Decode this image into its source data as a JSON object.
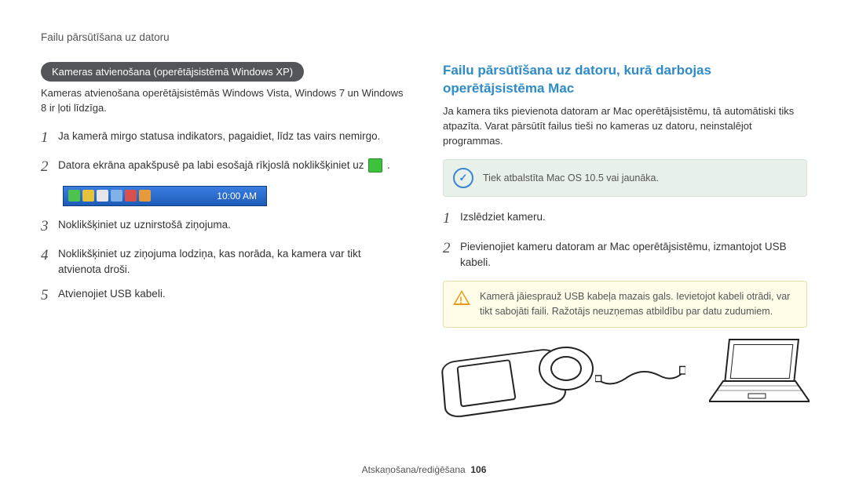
{
  "header": "Failu pārsūtīšana uz datoru",
  "left": {
    "pill": "Kameras atvienošana (operētājsistēmā Windows XP)",
    "subtext": "Kameras atvienošana operētājsistēmās Windows Vista, Windows 7 un Windows 8 ir ļoti līdzīga.",
    "steps": {
      "s1": "Ja kamerā mirgo statusa indikators, pagaidiet, līdz tas vairs nemirgo.",
      "s2a": "Datora ekrāna apakšpusē pa labi esošajā rīkjoslā noklikšķiniet uz ",
      "s2b": ".",
      "s3": "Noklikšķiniet uz uznirstošā ziņojuma.",
      "s4": "Noklikšķiniet uz ziņojuma lodziņa, kas norāda, ka kamera var tikt atvienota droši.",
      "s5": "Atvienojiet USB kabeli."
    },
    "taskbar_time": "10:00 AM"
  },
  "right": {
    "title": "Failu pārsūtīšana uz datoru, kurā darbojas operētājsistēma Mac",
    "intro": "Ja kamera tiks pievienota datoram ar Mac operētājsistēmu, tā automātiski tiks atpazīta. Varat pārsūtīt failus tieši no kameras uz datoru, neinstalējot programmas.",
    "info": "Tiek atbalstīta Mac OS 10.5 vai jaunāka.",
    "steps": {
      "s1": "Izslēdziet kameru.",
      "s2": "Pievienojiet kameru datoram ar Mac operētājsistēmu, izmantojot USB kabeli."
    },
    "warn": "Kamerā jāiesprauž USB kabeļa mazais gals. Ievietojot kabeli otrādi, var tikt sabojāti faili. Ražotājs neuzņemas atbildību par datu zudumiem."
  },
  "footer": {
    "section": "Atskaņošana/rediģēšana",
    "page": "106"
  }
}
